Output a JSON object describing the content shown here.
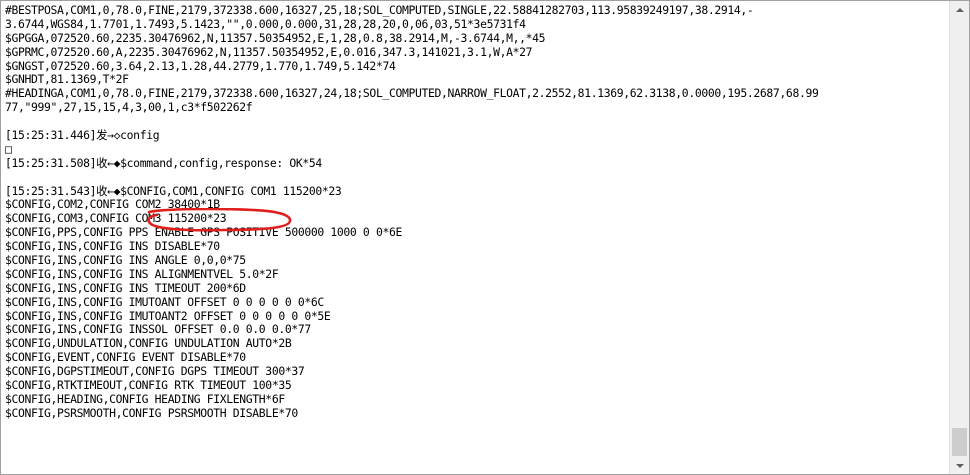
{
  "log": {
    "lines": [
      "#BESTPOSA,COM1,0,78.0,FINE,2179,372338.600,16327,25,18;SOL_COMPUTED,SINGLE,22.58841282703,113.95839249197,38.2914,-",
      "3.6744,WGS84,1.7701,1.7493,5.1423,\"\",0.000,0.000,31,28,28,20,0,06,03,51*3e5731f4",
      "$GPGGA,072520.60,2235.30476962,N,11357.50354952,E,1,28,0.8,38.2914,M,-3.6744,M,,*45",
      "$GPRMC,072520.60,A,2235.30476962,N,11357.50354952,E,0.016,347.3,141021,3.1,W,A*27",
      "$GNGST,072520.60,3.64,2.13,1.28,44.2779,1.770,1.749,5.142*74",
      "$GNHDT,81.1369,T*2F",
      "#HEADINGA,COM1,0,78.0,FINE,2179,372338.600,16327,24,18;SOL_COMPUTED,NARROW_FLOAT,2.2552,81.1369,62.3138,0.0000,195.2687,68.99",
      "77,\"999\",27,15,15,4,3,00,1,c3*f502262f",
      "",
      "[15:25:31.446]发→◇config",
      "□",
      "[15:25:31.508]收←◆$command,config,response: OK*54",
      "",
      "[15:25:31.543]收←◆$CONFIG,COM1,CONFIG COM1 115200*23",
      "$CONFIG,COM2,CONFIG COM2 38400*1B",
      "$CONFIG,COM3,CONFIG COM3 115200*23",
      "$CONFIG,PPS,CONFIG PPS ENABLE GPS POSITIVE 500000 1000 0 0*6E",
      "$CONFIG,INS,CONFIG INS DISABLE*70",
      "$CONFIG,INS,CONFIG INS ANGLE 0,0,0*75",
      "$CONFIG,INS,CONFIG INS ALIGNMENTVEL 5.0*2F",
      "$CONFIG,INS,CONFIG INS TIMEOUT 200*6D",
      "$CONFIG,INS,CONFIG IMUTOANT OFFSET 0 0 0 0 0 0*6C",
      "$CONFIG,INS,CONFIG IMUTOANT2 OFFSET 0 0 0 0 0 0*5E",
      "$CONFIG,INS,CONFIG INSSOL OFFSET 0.0 0.0 0.0*77",
      "$CONFIG,UNDULATION,CONFIG UNDULATION AUTO*2B",
      "$CONFIG,EVENT,CONFIG EVENT DISABLE*70",
      "$CONFIG,DGPSTIMEOUT,CONFIG DGPS TIMEOUT 300*37",
      "$CONFIG,RTKTIMEOUT,CONFIG RTK TIMEOUT 100*35",
      "$CONFIG,HEADING,CONFIG HEADING FIXLENGTH*6F",
      "$CONFIG,PSRSMOOTH,CONFIG PSRSMOOTH DISABLE*70"
    ]
  },
  "icons": {
    "scroll_up": "arrow-up-icon",
    "scroll_down": "arrow-down-icon"
  },
  "colors": {
    "text": "#000000",
    "background": "#ffffff",
    "annotation": "#e0201c",
    "scrollbar_track": "#f0f0f0",
    "scrollbar_thumb": "#cdcdcd"
  }
}
